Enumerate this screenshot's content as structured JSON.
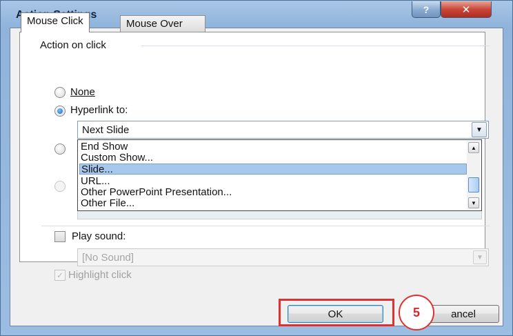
{
  "window": {
    "title": "Action Settings",
    "help_label": "?",
    "close_label": "✕"
  },
  "tabs": [
    {
      "label": "Mouse Click",
      "active": true
    },
    {
      "label": "Mouse Over",
      "active": false
    }
  ],
  "action_group": {
    "label": "Action on click",
    "options": [
      {
        "label": "None",
        "checked": false
      },
      {
        "label": "Hyperlink to:",
        "checked": true
      }
    ],
    "hyperlink_selected": "Next Slide",
    "dropdown_items": [
      {
        "label": "End Show",
        "selected": false
      },
      {
        "label": "Custom Show...",
        "selected": false
      },
      {
        "label": "Slide...",
        "selected": true
      },
      {
        "label": "URL...",
        "selected": false
      },
      {
        "label": "Other PowerPoint Presentation...",
        "selected": false
      },
      {
        "label": "Other File...",
        "selected": false
      }
    ]
  },
  "sound": {
    "play_label": "Play sound:",
    "play_checked": false,
    "sound_value": "[No Sound]",
    "highlight_label": "Highlight click",
    "highlight_checked": true
  },
  "buttons": {
    "ok_label": "OK",
    "cancel_label": "ancel"
  },
  "annotation": {
    "step_number": "5",
    "color": "#e03030"
  },
  "colors": {
    "selection": "#a5c8ec",
    "title_bar": "#9cbde2",
    "close_button": "#c9463a"
  }
}
